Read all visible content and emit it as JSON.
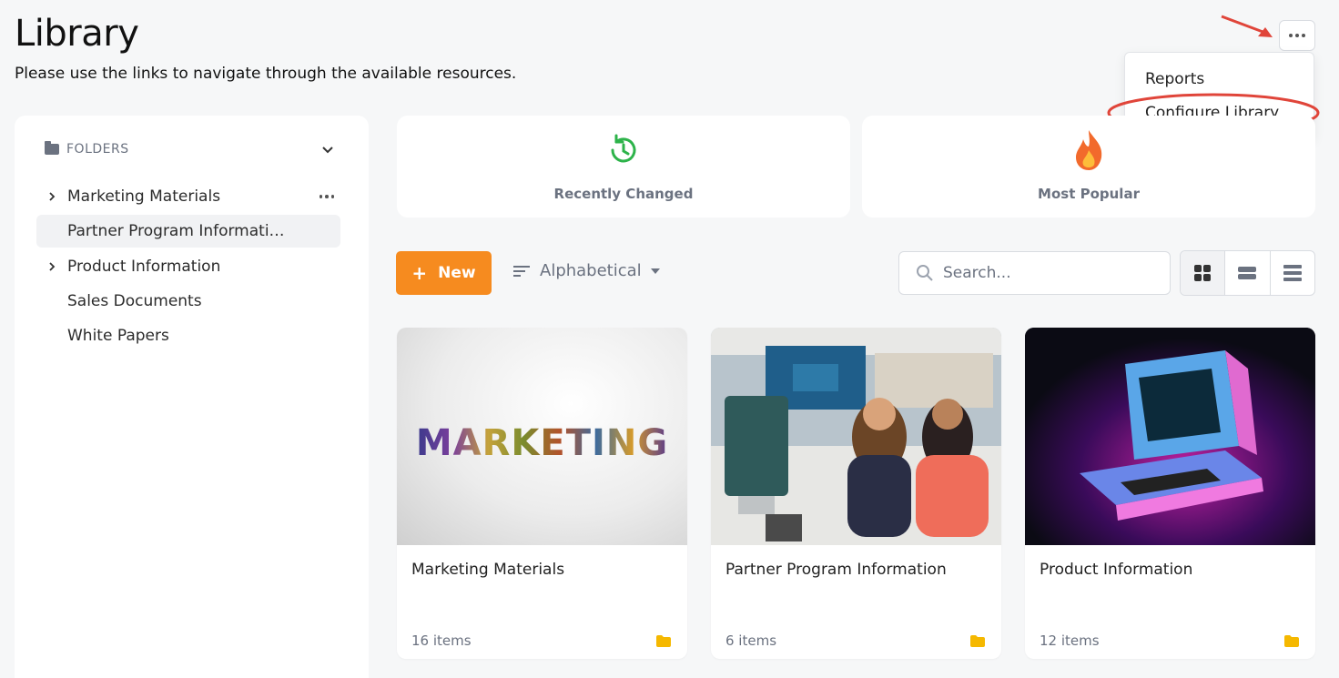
{
  "header": {
    "title": "Library",
    "subtitle": "Please use the links to navigate through the available resources."
  },
  "menu": {
    "items": [
      "Reports",
      "Configure Library"
    ]
  },
  "sidebar": {
    "header": "FOLDERS",
    "items": [
      {
        "label": "Marketing Materials",
        "expandable": true
      },
      {
        "label": "Partner Program Informati…",
        "expandable": false,
        "selected": true
      },
      {
        "label": "Product Information",
        "expandable": true
      },
      {
        "label": "Sales Documents",
        "expandable": false
      },
      {
        "label": "White Papers",
        "expandable": false
      }
    ]
  },
  "quick_links": [
    {
      "label": "Recently Changed",
      "icon": "clock-refresh-icon"
    },
    {
      "label": "Most Popular",
      "icon": "fire-icon"
    }
  ],
  "toolbar": {
    "new_label": "New",
    "sort_label": "Alphabetical",
    "search_placeholder": "Search..."
  },
  "cards": [
    {
      "title": "Marketing Materials",
      "count": "16 items",
      "thumb_text": "MARKETING"
    },
    {
      "title": "Partner Program Information",
      "count": "6 items"
    },
    {
      "title": "Product Information",
      "count": "12 items"
    }
  ],
  "colors": {
    "accent": "#f68b1f",
    "folder": "#f5b800",
    "annotation": "#e0453a",
    "recent_icon": "#2db34a"
  }
}
